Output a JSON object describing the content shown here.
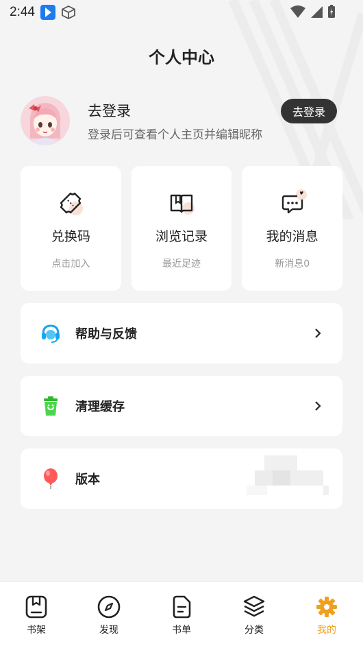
{
  "status_bar": {
    "time": "2:44"
  },
  "page": {
    "title": "个人中心"
  },
  "profile": {
    "title": "去登录",
    "subtitle": "登录后可查看个人主页并编辑昵称",
    "login_button": "去登录"
  },
  "cards": [
    {
      "title": "兑换码",
      "subtitle": "点击加入",
      "icon": "ticket-icon"
    },
    {
      "title": "浏览记录",
      "subtitle": "最近足迹",
      "icon": "book-icon"
    },
    {
      "title": "我的消息",
      "subtitle": "新消息0",
      "icon": "message-icon"
    }
  ],
  "menu": [
    {
      "label": "帮助与反馈",
      "icon": "headset-icon",
      "color": "#1aa3f0"
    },
    {
      "label": "清理缓存",
      "icon": "trash-icon",
      "color": "#33cc33"
    },
    {
      "label": "版本",
      "icon": "balloon-icon",
      "color": "#ff5a5a"
    }
  ],
  "tabs": [
    {
      "label": "书架",
      "icon": "bookmark-icon"
    },
    {
      "label": "发现",
      "icon": "compass-icon"
    },
    {
      "label": "书单",
      "icon": "list-doc-icon"
    },
    {
      "label": "分类",
      "icon": "layers-icon"
    },
    {
      "label": "我的",
      "icon": "gear-icon",
      "active": true
    }
  ],
  "colors": {
    "accent": "#f0a020",
    "dark_button": "#333333",
    "background": "#f4f4f4"
  }
}
